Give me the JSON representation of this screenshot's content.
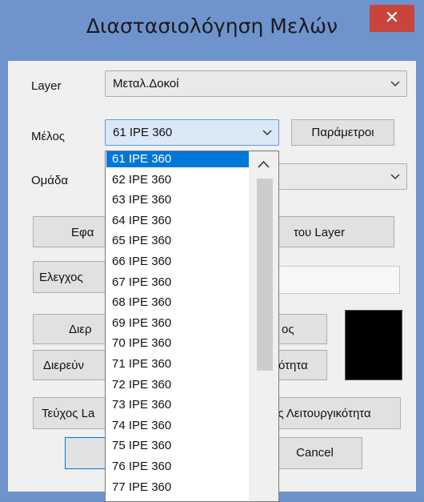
{
  "window": {
    "title": "Διαστασιολόγηση Μελών",
    "close_label": "✕"
  },
  "colors": {
    "accent": "#0078d7",
    "close": "#c8453e",
    "frame": "#6f93cc",
    "swatch": "#000000"
  },
  "form": {
    "layer_label": "Layer",
    "layer_value": "Μεταλ.Δοκοί",
    "member_label": "Μέλος",
    "member_value": "61 IPE 360",
    "params_button": "Παράμετροι",
    "group_label": "Ομάδα"
  },
  "buttons": {
    "b1_left": "Εφα",
    "b1_right": "του Layer",
    "b2_left": "Ελεγχος",
    "b3_left": "Διερ",
    "b3_right": "ος",
    "b4_left": "Διερεύν",
    "b4_right": "ότητα",
    "b5_left": "Τεύχος La",
    "b5_right": "ος Λειτουργικότητα",
    "cancel": "Cancel"
  },
  "dropdown": {
    "items": [
      "61 IPE 360",
      "62 IPE 360",
      "63 IPE 360",
      "64 IPE 360",
      "65 IPE 360",
      "66 IPE 360",
      "67 IPE 360",
      "68 IPE 360",
      "69 IPE 360",
      "70 IPE 360",
      "71 IPE 360",
      "72 IPE 360",
      "73 IPE 360",
      "74 IPE 360",
      "75 IPE 360",
      "76 IPE 360",
      "77 IPE 360"
    ],
    "selected_index": 0
  }
}
